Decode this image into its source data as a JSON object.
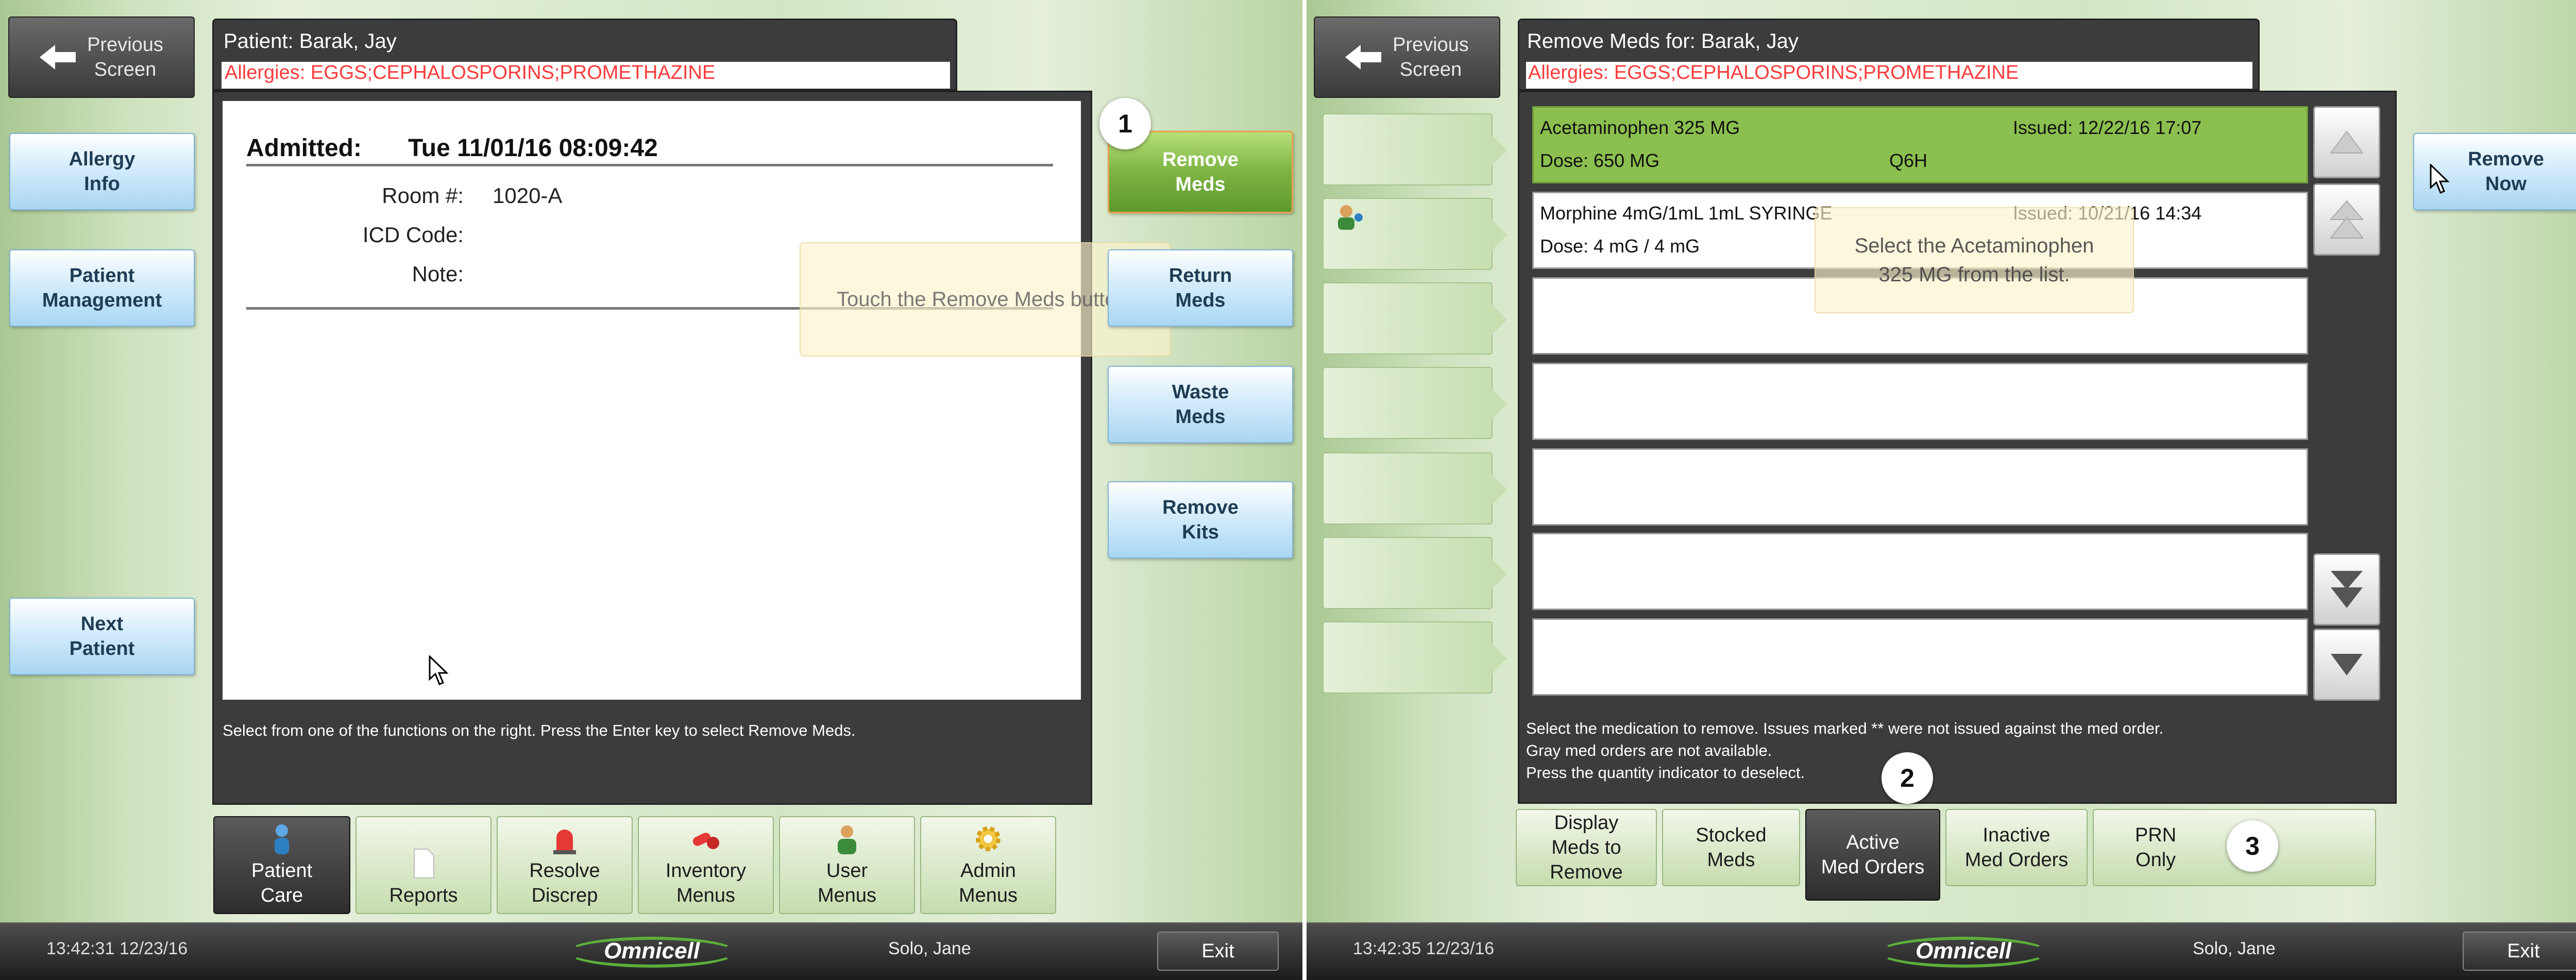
{
  "left": {
    "prev_button": "Previous\nScreen",
    "patient_title": "Patient: Barak, Jay",
    "allergies": "Allergies: EGGS;CEPHALOSPORINS;PROMETHAZINE",
    "admitted_label": "Admitted:",
    "admitted_value": "Tue 11/01/16 08:09:42",
    "room_label": "Room #:",
    "room_value": "1020-A",
    "icd_label": "ICD Code:",
    "note_label": "Note:",
    "instruction": "Select from one of the functions on the right.  Press the Enter key to select Remove Meds.",
    "tooltip": "Touch the Remove Meds button.",
    "callout": "1",
    "side_buttons": [
      "Allergy\nInfo",
      "Patient\nManagement",
      "Next\nPatient"
    ],
    "action_buttons": [
      "Remove\nMeds",
      "Return\nMeds",
      "Waste\nMeds",
      "Remove\nKits"
    ],
    "tabs": [
      "Patient\nCare",
      "Reports",
      "Resolve\nDiscrep",
      "Inventory\nMenus",
      "User\nMenus",
      "Admin\nMenus"
    ],
    "footer_time": "13:42:31  12/23/16",
    "footer_user": "Solo, Jane",
    "exit": "Exit",
    "logo": "Omnicell"
  },
  "right": {
    "prev_button": "Previous\nScreen",
    "title": "Remove Meds for: Barak, Jay",
    "allergies": "Allergies: EGGS;CEPHALOSPORINS;PROMETHAZINE",
    "meds": [
      {
        "name": "Acetaminophen 325 MG",
        "issued": "Issued: 12/22/16 17:07",
        "dose": "Dose: 650 MG",
        "freq": "Q6H"
      },
      {
        "name": "Morphine 4mG/1mL 1mL SYRINGE",
        "issued": "Issued: 10/21/16 14:34",
        "dose": "Dose: 4 mG / 4 mG",
        "freq": ""
      }
    ],
    "tooltip": "Select the Acetaminophen\n325 MG from the list.",
    "instruction": "Select the medication to remove. Issues marked ** were not issued against the med order.\nGray med orders are not available.\nPress the quantity indicator to deselect.",
    "callout2": "2",
    "callout3": "3",
    "remove_now": "Remove\nNow",
    "tabs": [
      "Display\nMeds to\nRemove",
      "Stocked\nMeds",
      "Active\nMed Orders",
      "Inactive\nMed Orders",
      "PRN\nOnly"
    ],
    "footer_time": "13:42:35  12/23/16",
    "footer_user": "Solo, Jane",
    "exit": "Exit",
    "logo": "Omnicell"
  }
}
